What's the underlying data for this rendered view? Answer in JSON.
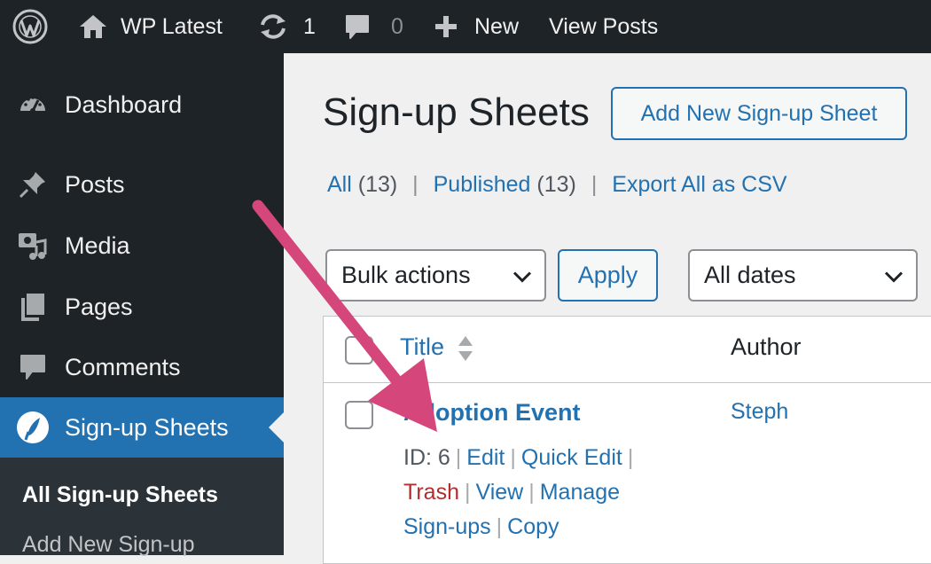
{
  "admin_bar": {
    "site_name": "WP Latest",
    "updates_count": "1",
    "comments_count": "0",
    "new_label": "New",
    "view_posts_label": "View Posts"
  },
  "sidebar": {
    "items": [
      {
        "label": "Dashboard",
        "icon": "dashboard-icon"
      },
      {
        "label": "Posts",
        "icon": "pin-icon"
      },
      {
        "label": "Media",
        "icon": "media-icon"
      },
      {
        "label": "Pages",
        "icon": "pages-icon"
      },
      {
        "label": "Comments",
        "icon": "comments-icon"
      },
      {
        "label": "Sign-up Sheets",
        "icon": "signup-sheets-icon",
        "active": true
      }
    ],
    "submenu": [
      "All Sign-up Sheets",
      "Add New Sign-up"
    ]
  },
  "main": {
    "title": "Sign-up Sheets",
    "add_new_label": "Add New Sign-up Sheet",
    "filters": {
      "all_label": "All",
      "all_count": "(13)",
      "published_label": "Published",
      "published_count": "(13)",
      "export_label": "Export All as CSV",
      "separator": "|"
    },
    "bulk_actions": {
      "selected": "Bulk actions"
    },
    "apply_label": "Apply",
    "dates": {
      "selected": "All dates"
    },
    "table": {
      "columns": [
        "Title",
        "Author"
      ],
      "rows": [
        {
          "title": "Adoption Event",
          "author": "Steph",
          "id_text": "ID: 6",
          "actions": {
            "edit": "Edit",
            "quick_edit": "Quick Edit",
            "trash": "Trash",
            "view": "View",
            "manage": "Manage",
            "signups": "Sign-ups",
            "copy": "Copy"
          }
        }
      ]
    }
  },
  "colors": {
    "accent": "#2271b1",
    "admin_bar_bg": "#1d2327",
    "trash": "#b32d2e",
    "annotation_arrow": "#d5467a"
  }
}
